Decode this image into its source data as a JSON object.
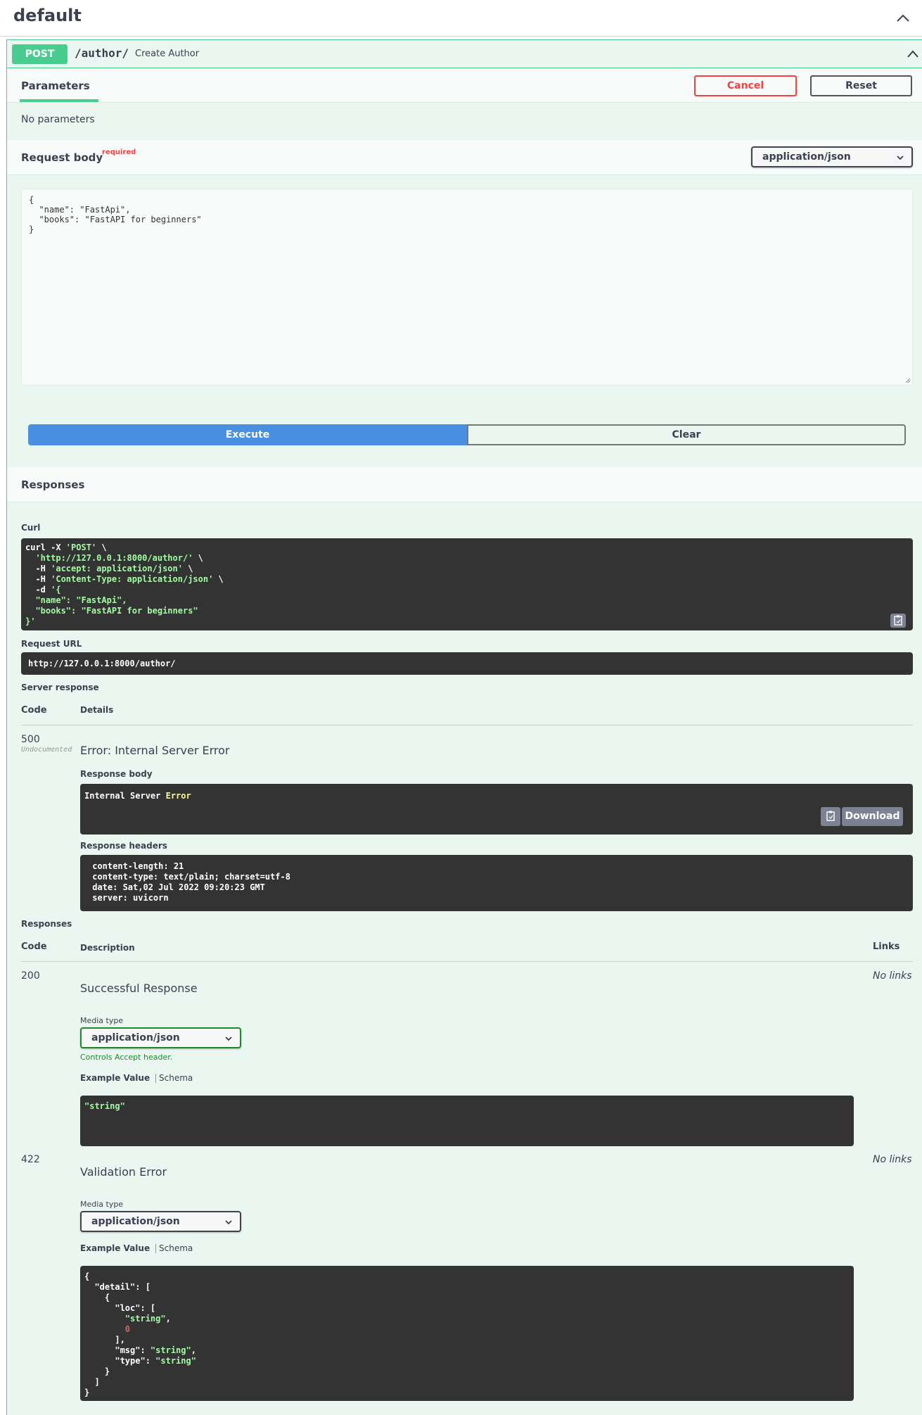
{
  "tag": {
    "title": "default"
  },
  "operation": {
    "method": "POST",
    "path": "/author/",
    "summary": "Create Author",
    "tab_parameters": "Parameters",
    "cancel_label": "Cancel",
    "reset_label": "Reset",
    "no_parameters": "No parameters",
    "request_body_title": "Request body",
    "required_label": "required",
    "content_type": "application/json",
    "request_body_value": "{\n  \"name\": \"FastApi\",\n  \"books\": \"FastAPI for beginners\"\n}",
    "execute_label": "Execute",
    "clear_label": "Clear",
    "responses_title": "Responses"
  },
  "live_response": {
    "curl_label": "Curl",
    "curl_lines": [
      {
        "w": "curl -X ",
        "g": "'POST'",
        "t": " \\"
      },
      {
        "w": "  ",
        "g": "'http://127.0.0.1:8000/author/'",
        "t": " \\"
      },
      {
        "w": "  -H ",
        "g": "'accept: application/json'",
        "t": " \\"
      },
      {
        "w": "  -H ",
        "g": "'Content-Type: application/json'",
        "t": " \\"
      },
      {
        "w": "  -d ",
        "g": "'{",
        "t": ""
      },
      {
        "w": "",
        "g": "  \"name\": \"FastApi\",",
        "t": ""
      },
      {
        "w": "",
        "g": "  \"books\": \"FastAPI for beginners\"",
        "t": ""
      },
      {
        "w": "",
        "g": "}'",
        "t": ""
      }
    ],
    "request_url_label": "Request URL",
    "request_url": "http://127.0.0.1:8000/author/",
    "server_response_label": "Server response",
    "col_code": "Code",
    "col_details": "Details",
    "code": "500",
    "undocumented": "Undocumented",
    "error_text": "Error: Internal Server Error",
    "response_body_label": "Response body",
    "response_body_plain": "Internal Server ",
    "response_body_hl": "Error",
    "download_label": "Download",
    "response_headers_label": "Response headers",
    "response_headers": " content-length: 21\n content-type: text/plain; charset=utf-8\n date: Sat,02 Jul 2022 09:20:23 GMT\n server: uvicorn"
  },
  "responses": {
    "title": "Responses",
    "col_code": "Code",
    "col_description": "Description",
    "col_links": "Links",
    "media_type_label": "Media type",
    "controls_accept": "Controls Accept header.",
    "example_value_label": "Example Value",
    "schema_label": "Schema",
    "items": [
      {
        "code": "200",
        "description": "Successful Response",
        "links": "No links",
        "media_type": "application/json",
        "example": "\"string\""
      },
      {
        "code": "422",
        "description": "Validation Error",
        "links": "No links",
        "media_type": "application/json"
      }
    ]
  },
  "colors": {
    "post_green": "#49cc90",
    "execute_blue": "#4990e2",
    "cancel_red": "#f93e3e",
    "code_bg": "#333333"
  }
}
